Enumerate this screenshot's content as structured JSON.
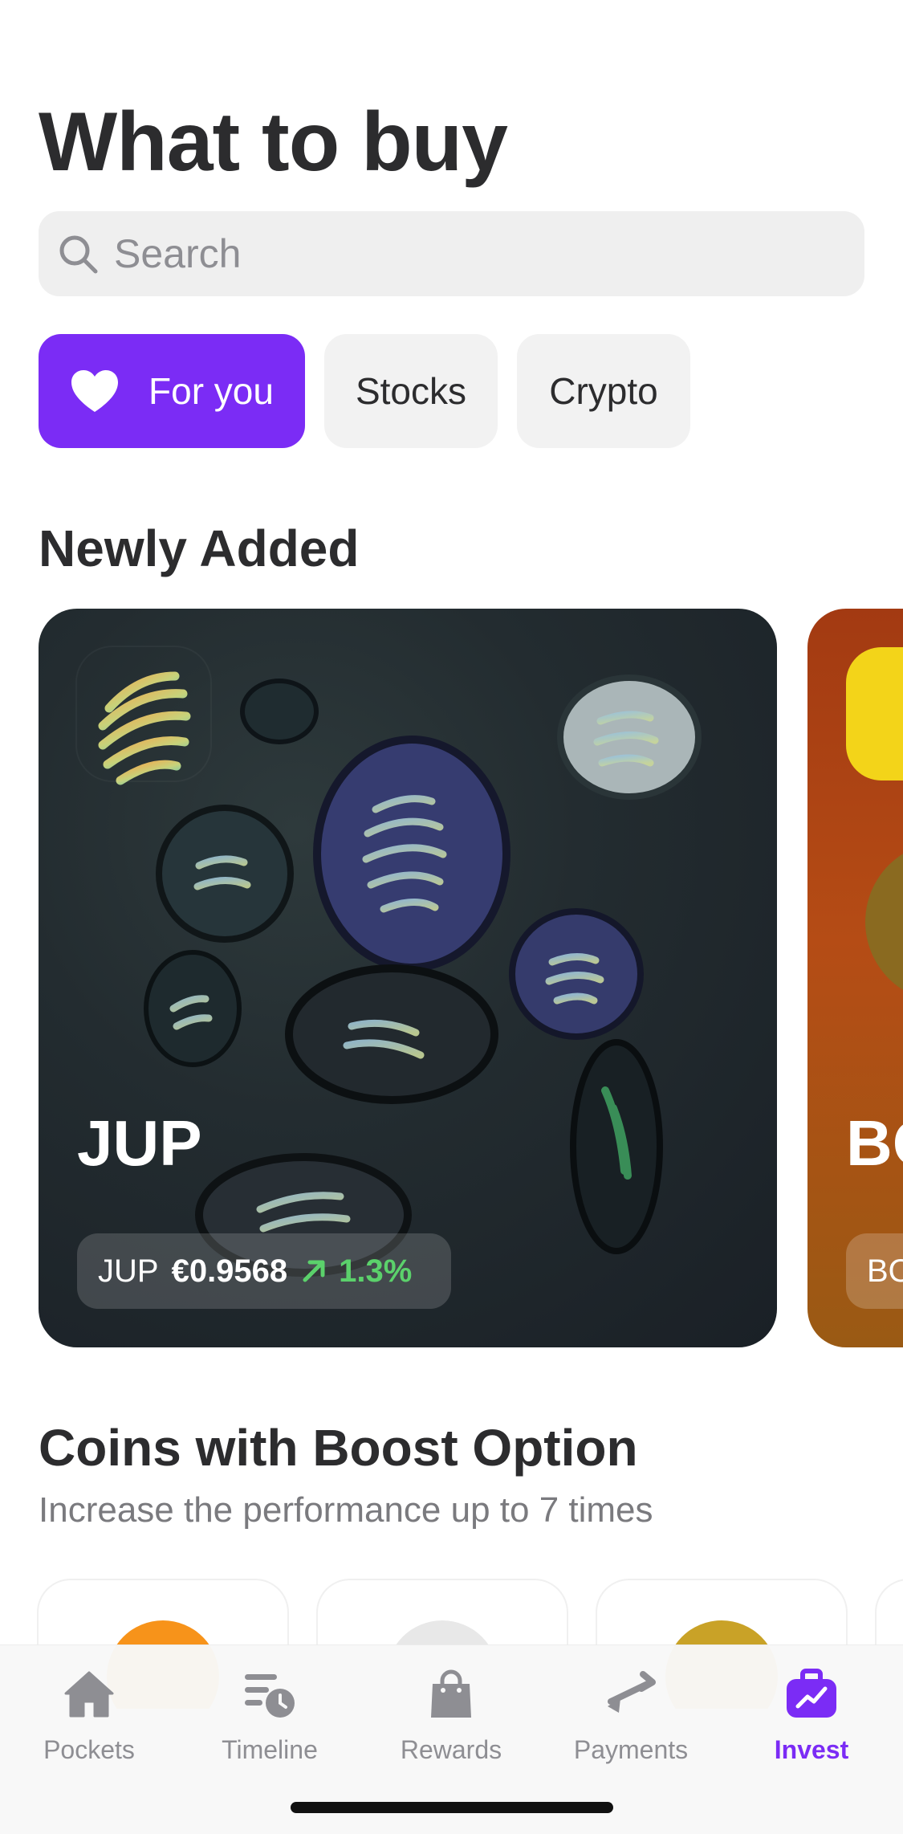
{
  "page": {
    "title": "What to buy"
  },
  "search": {
    "placeholder": "Search"
  },
  "filters": [
    {
      "label": "For you",
      "icon": "heart-icon",
      "selected": true
    },
    {
      "label": "Stocks",
      "selected": false
    },
    {
      "label": "Crypto",
      "selected": false
    }
  ],
  "newly_added": {
    "title": "Newly Added",
    "cards": [
      {
        "name": "JUP",
        "symbol": "JUP",
        "price": "€0.9568",
        "change": "1.3%",
        "trend": "up"
      },
      {
        "name": "BO",
        "symbol": "BO"
      }
    ]
  },
  "boost": {
    "title": "Coins with Boost Option",
    "subtitle": "Increase the performance up to 7 times"
  },
  "tabbar": {
    "items": [
      {
        "label": "Pockets",
        "icon": "home-icon"
      },
      {
        "label": "Timeline",
        "icon": "timeline-icon"
      },
      {
        "label": "Rewards",
        "icon": "shopping-bag-icon"
      },
      {
        "label": "Payments",
        "icon": "transfer-arrows-icon"
      },
      {
        "label": "Invest",
        "icon": "briefcase-chart-icon",
        "active": true
      }
    ]
  },
  "colors": {
    "accent": "#7b2cf5",
    "positive": "#5bd16b",
    "text": "#2c2c2e",
    "muted": "#8e8e93"
  }
}
